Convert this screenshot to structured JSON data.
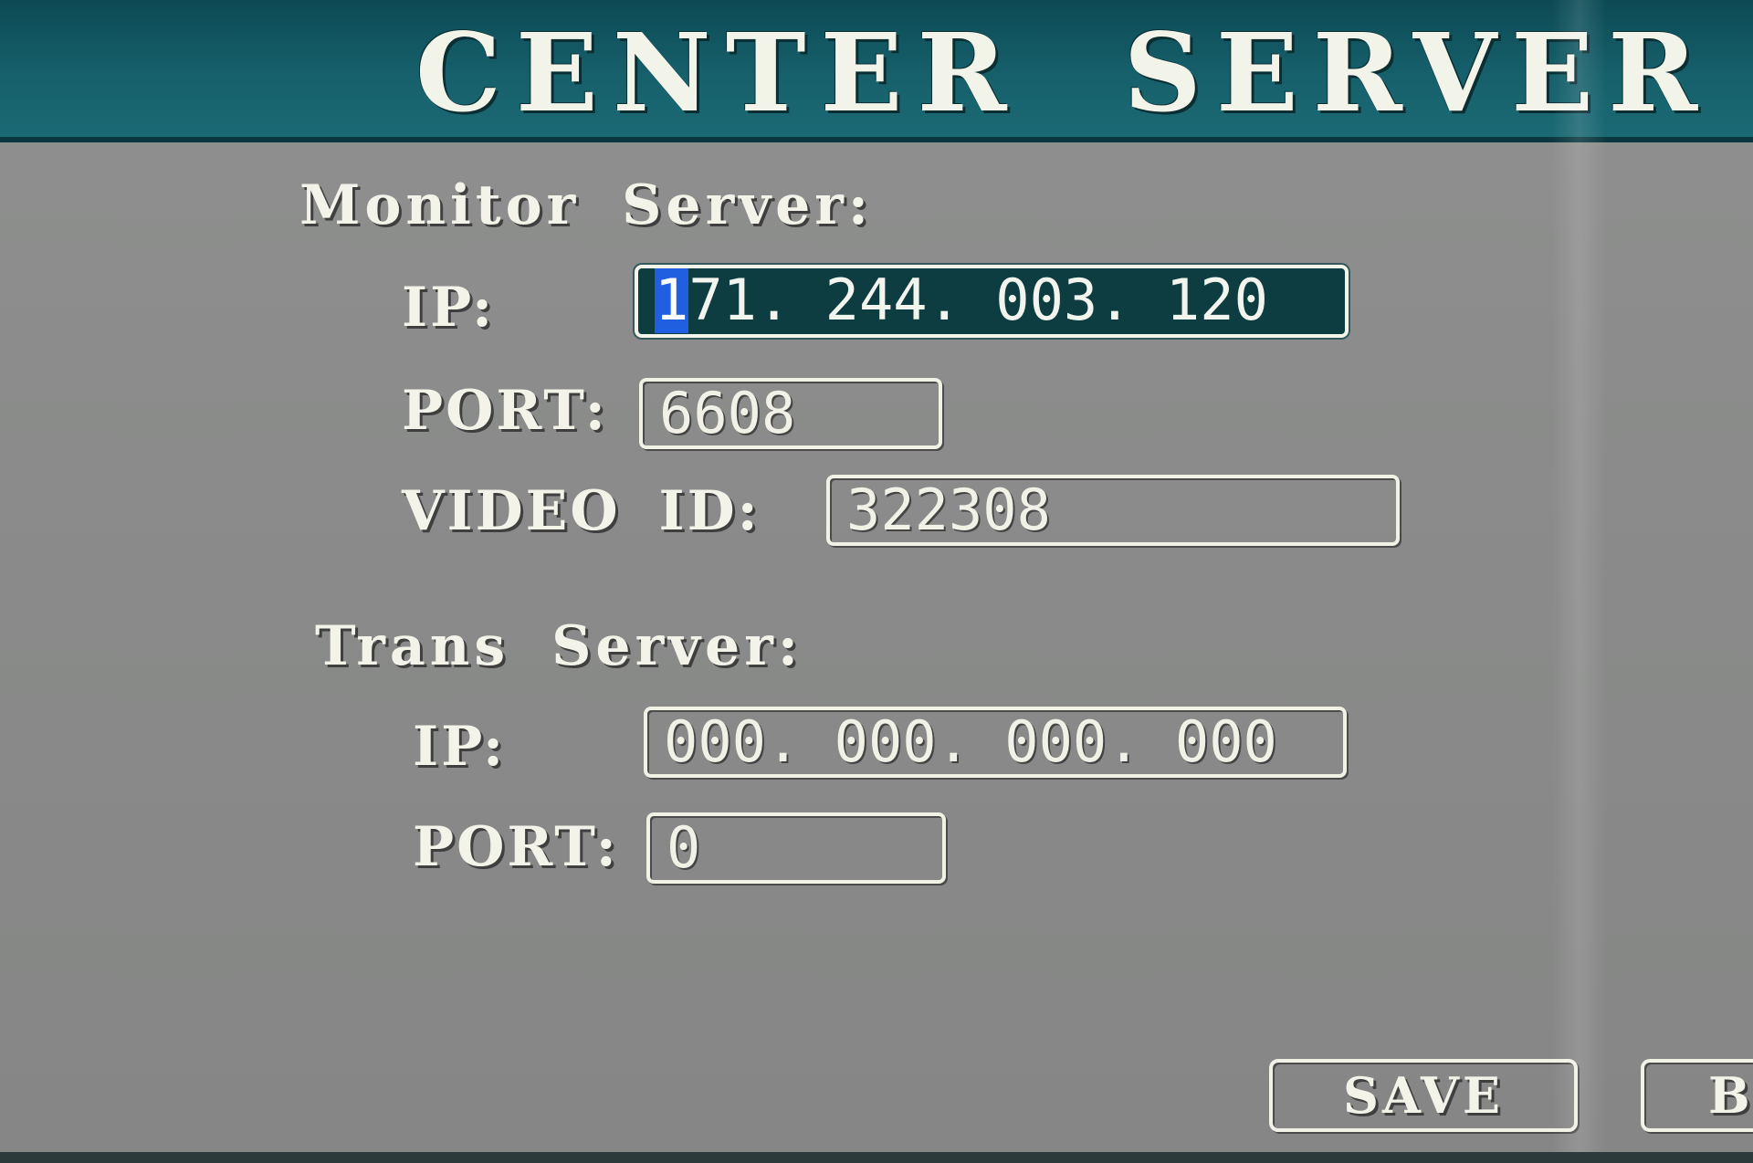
{
  "title": "CENTER SERVER",
  "monitor_server": {
    "heading": "Monitor Server:",
    "ip_label": "IP:",
    "ip_value_first": "1",
    "ip_value_rest": "71. 244. 003. 120",
    "port_label": "PORT:",
    "port_value": "6608",
    "video_id_label": "VIDEO ID:",
    "video_id_value": "322308"
  },
  "trans_server": {
    "heading": "Trans Server:",
    "ip_label": "IP:",
    "ip_value": "000. 000. 000. 000",
    "port_label": "PORT:",
    "port_value": "0"
  },
  "buttons": {
    "save_label": "SAVE",
    "back_label_partial": "B"
  },
  "colors": {
    "title_bar": "#16606b",
    "panel": "#8b8c8b",
    "selected_field": "#0d3d40",
    "cursor": "#1f5fe0",
    "text": "#f2f2ea"
  }
}
